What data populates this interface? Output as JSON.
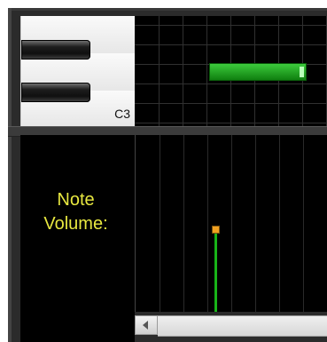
{
  "piano": {
    "octave_label": "C3"
  },
  "volume_panel": {
    "label_line1": "Note",
    "label_line2": "Volume:"
  },
  "colors": {
    "note_fill": "#22a822",
    "volume_stem": "#18b418",
    "volume_knob": "#f0a020",
    "label_yellow": "#e8e840"
  }
}
